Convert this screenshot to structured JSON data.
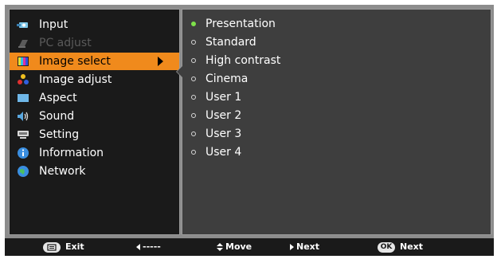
{
  "menu": {
    "items": [
      {
        "label": "Input",
        "icon": "input-icon",
        "state": "normal"
      },
      {
        "label": "PC adjust",
        "icon": "pc-adjust-icon",
        "state": "disabled"
      },
      {
        "label": "Image select",
        "icon": "image-select-icon",
        "state": "selected"
      },
      {
        "label": "Image adjust",
        "icon": "image-adjust-icon",
        "state": "normal"
      },
      {
        "label": "Aspect",
        "icon": "aspect-icon",
        "state": "normal"
      },
      {
        "label": "Sound",
        "icon": "sound-icon",
        "state": "normal"
      },
      {
        "label": "Setting",
        "icon": "setting-icon",
        "state": "normal"
      },
      {
        "label": "Information",
        "icon": "information-icon",
        "state": "normal"
      },
      {
        "label": "Network",
        "icon": "network-icon",
        "state": "normal"
      }
    ]
  },
  "options": {
    "selected": "Presentation",
    "items": [
      "Presentation",
      "Standard",
      "High contrast",
      "Cinema",
      "User 1",
      "User 2",
      "User 3",
      "User 4"
    ]
  },
  "footer": {
    "exit": "Exit",
    "back": "-----",
    "move": "Move",
    "next": "Next",
    "ok_badge": "OK",
    "ok_next": "Next"
  },
  "colors": {
    "highlight": "#f08a1c",
    "selected_dot": "#7ee14a"
  }
}
